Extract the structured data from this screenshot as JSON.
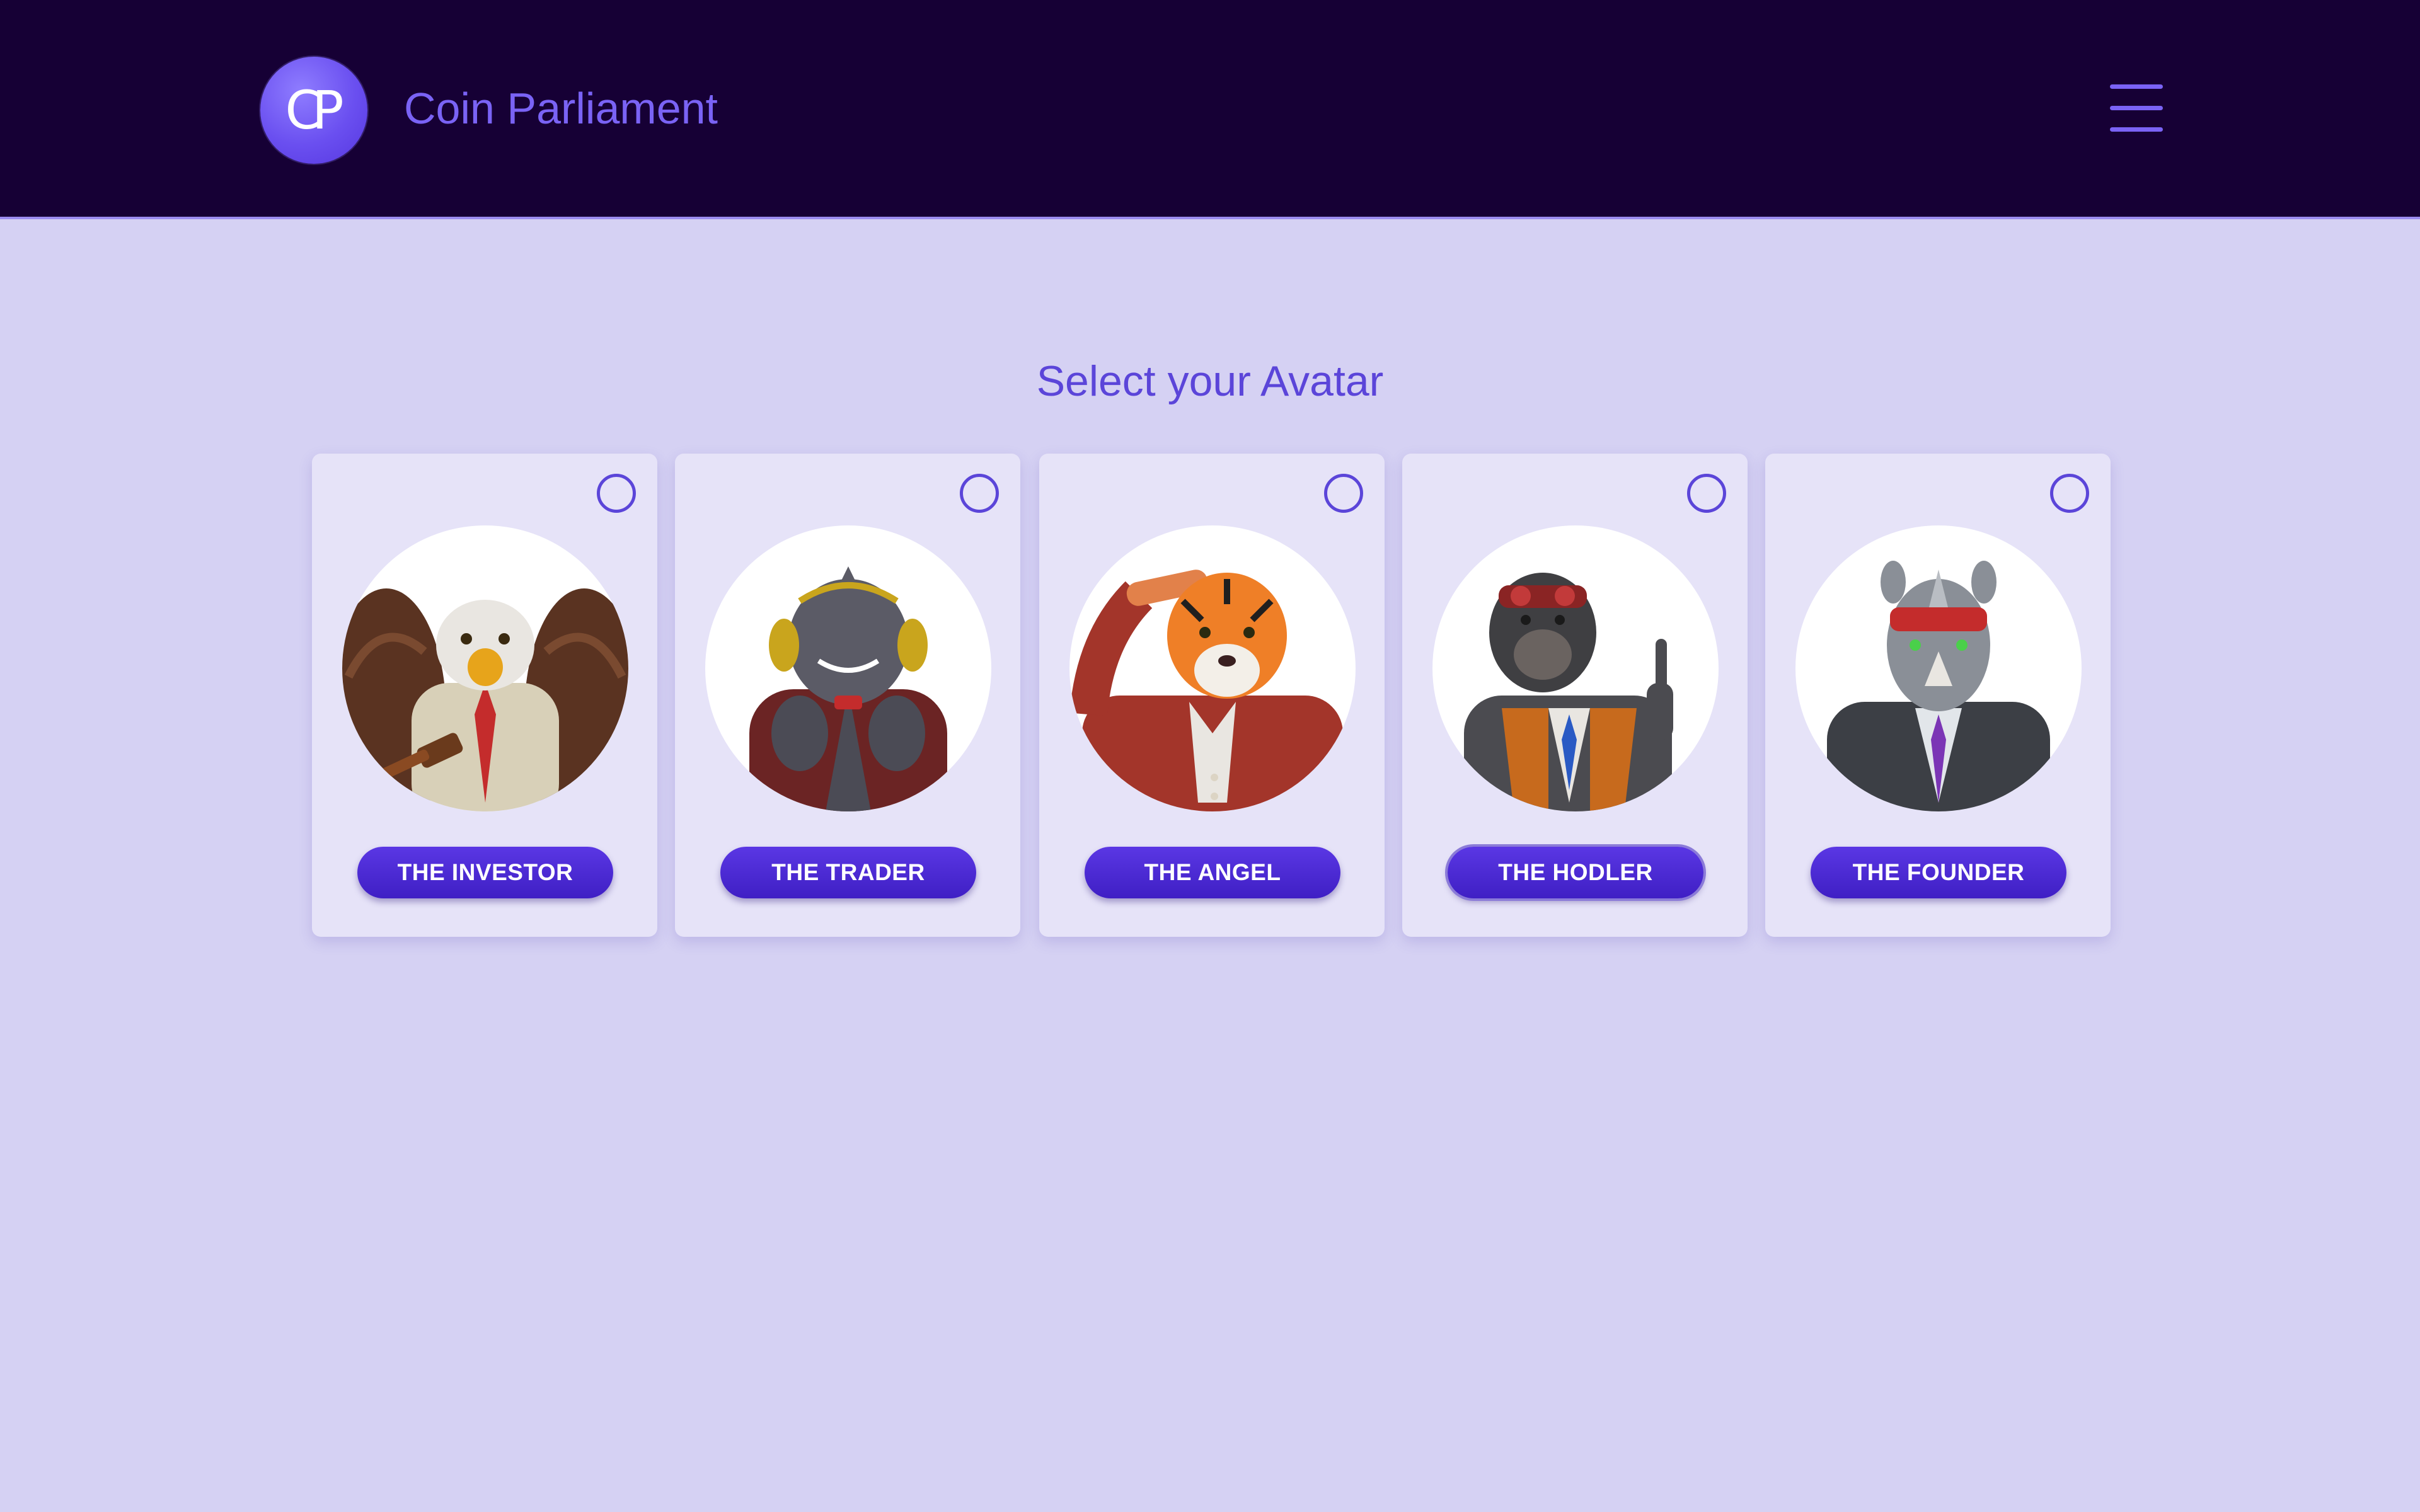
{
  "header": {
    "logo_text": "CP",
    "brand_name": "Coin Parliament",
    "menu_icon": "hamburger-menu-icon"
  },
  "main": {
    "title": "Select your Avatar",
    "avatars": [
      {
        "label": "THE INVESTOR",
        "icon": "eagle-avatar-icon"
      },
      {
        "label": "THE TRADER",
        "icon": "shark-avatar-icon"
      },
      {
        "label": "THE ANGEL",
        "icon": "tiger-avatar-icon"
      },
      {
        "label": "THE HODLER",
        "icon": "gorilla-avatar-icon"
      },
      {
        "label": "THE FOUNDER",
        "icon": "rhino-avatar-icon"
      }
    ]
  },
  "colors": {
    "header_bg": "#160035",
    "page_bg": "#d5d1f3",
    "accent": "#5b45d9",
    "brand_text": "#7a63f5",
    "card_bg": "#e6e3f8",
    "button_bg": "#4a2ad4"
  }
}
